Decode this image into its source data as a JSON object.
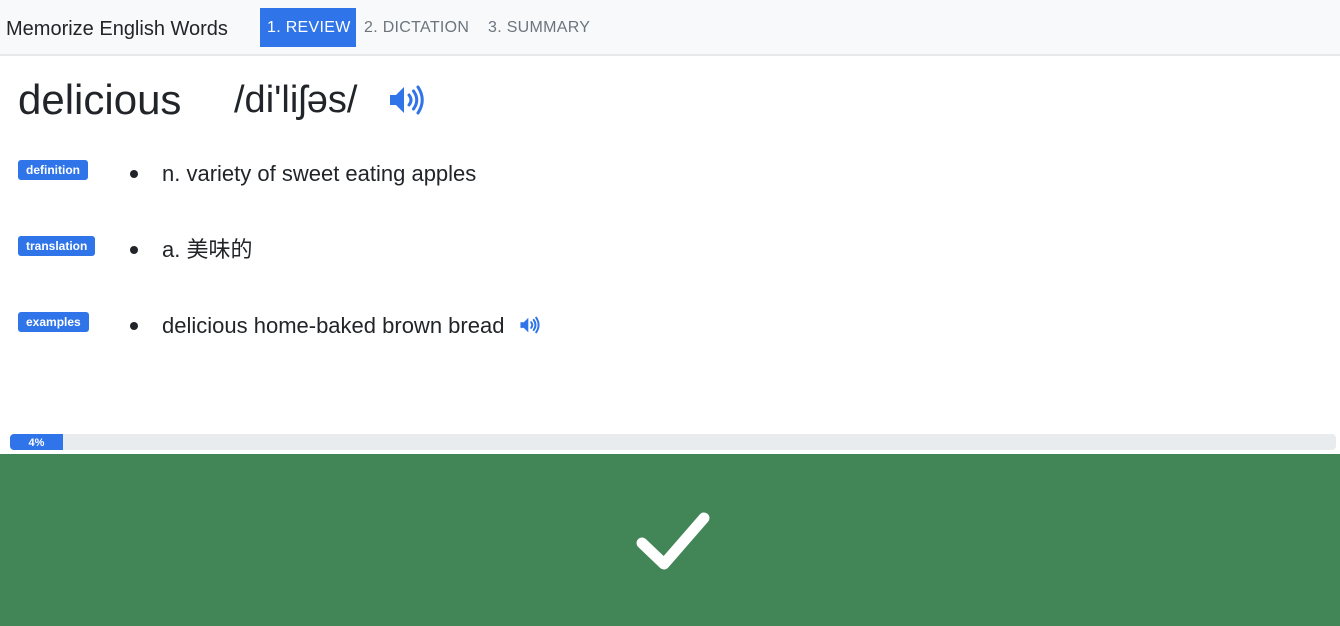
{
  "header": {
    "brand": "Memorize English Words",
    "tabs": [
      {
        "label": "1. REVIEW",
        "active": true
      },
      {
        "label": "2. DICTATION",
        "active": false
      },
      {
        "label": "3. SUMMARY",
        "active": false
      }
    ]
  },
  "word": {
    "text": "delicious",
    "phonetic": "/di'liʃəs/",
    "speaker_icon": "volume-icon"
  },
  "sections": [
    {
      "badge": "definition",
      "text": "n. variety of sweet eating apples"
    },
    {
      "badge": "translation",
      "text": "a. 美味的"
    },
    {
      "badge": "examples",
      "text": "delicious home-baked brown bread",
      "speaker_icon": "volume-icon"
    }
  ],
  "progress": {
    "label": "4%",
    "value": 0.04
  },
  "confirm": {
    "icon": "checkmark-icon"
  },
  "colors": {
    "accent": "#2f74e8",
    "confirm_bg": "#428557",
    "navbar_bg": "#f8f9fa"
  }
}
